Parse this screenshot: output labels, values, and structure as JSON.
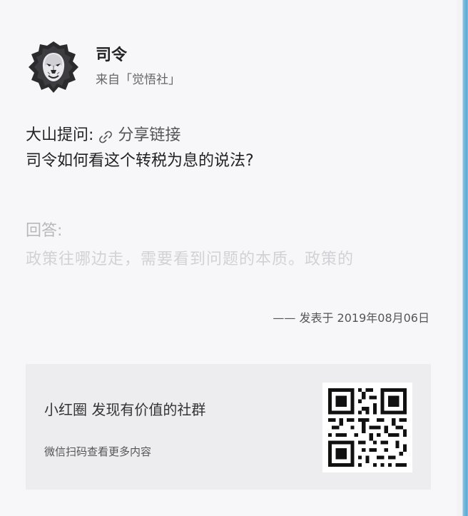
{
  "author": {
    "name": "司令",
    "source": "来自「觉悟社」",
    "avatar_icon": "lion-avatar-icon"
  },
  "question": {
    "asker_prefix": "大山提问:",
    "share_label": "分享链接",
    "share_icon": "link-icon",
    "text": "司令如何看这个转税为息的说法?"
  },
  "answer": {
    "label": "回答:",
    "preview": "政策往哪边走，需要看到问题的本质。政策的"
  },
  "meta": {
    "published": "—— 发表于 2019年08月06日"
  },
  "promo": {
    "title": "小红圈 发现有价值的社群",
    "subtitle": "微信扫码查看更多内容",
    "qr_icon": "qr-code-icon"
  },
  "colors": {
    "background": "#f7f7f9",
    "promo_background": "#ededf0",
    "edge_accent": "#5aa9d6"
  }
}
